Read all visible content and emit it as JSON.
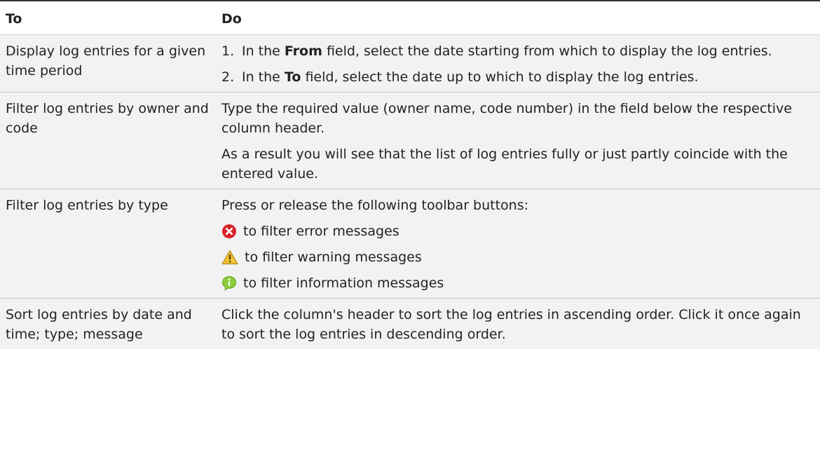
{
  "table": {
    "header": {
      "to": "To",
      "do": "Do"
    },
    "row_time_period": {
      "to": "Display log entries for a given time period",
      "step1": {
        "num": "1.",
        "pre": "In the ",
        "field": "From",
        "post": " field, select the date starting from which to display the log entries."
      },
      "step2": {
        "num": "2.",
        "pre": "In the ",
        "field": "To",
        "post": " field, select the date up to which to display the log entries."
      }
    },
    "row_owner_code": {
      "to": "Filter log entries by owner and code",
      "para1": "Type the required value (owner name, code number) in the field below the respective column header.",
      "para2": "As a result you will see that the list of log entries fully or just partly coincide with the entered value."
    },
    "row_type": {
      "to": "Filter log entries by type",
      "intro": "Press or release the following toolbar buttons:",
      "error": {
        "icon": "error-icon",
        "color": "#d8232a",
        "text": "to filter error messages"
      },
      "warning": {
        "icon": "warning-icon",
        "color": "#f2c335",
        "text": "to filter warning messages"
      },
      "info": {
        "icon": "info-icon",
        "color": "#8ccf3c",
        "text": "to filter information messages"
      }
    },
    "row_sort": {
      "to": "Sort log entries by date and time; type; message",
      "para": "Click the column's header to sort the log entries in ascending order. Click it once again to sort the log entries in descending order."
    }
  }
}
